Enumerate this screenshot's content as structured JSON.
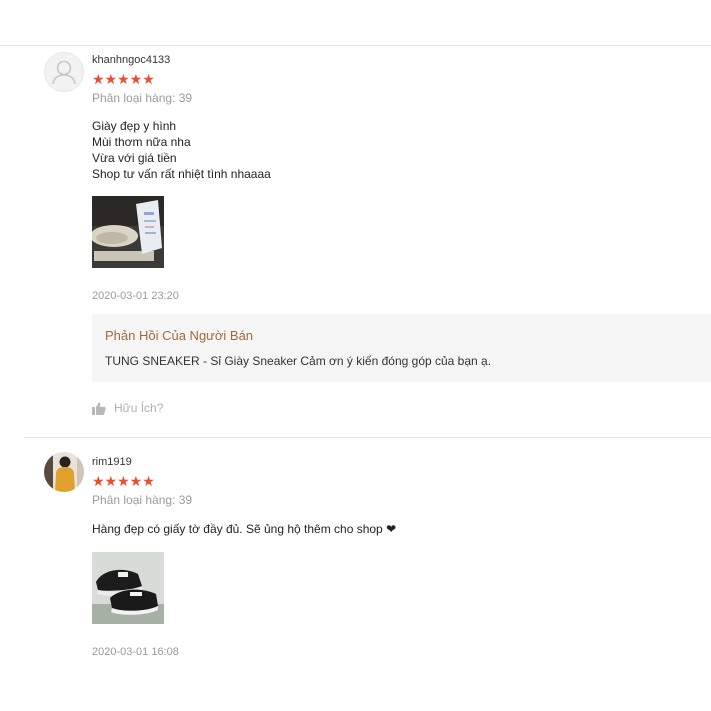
{
  "reviews": [
    {
      "username": "khanhngoc4133",
      "stars": "★★★★★",
      "variation": "Phân loại hàng: 39",
      "comment_lines": [
        "Giày đẹp y hình",
        "Mùi thơm nữa nha",
        "Vừa với giá tiền",
        "Shop tư vấn rất nhiệt tình nhaaaa"
      ],
      "rating": 5,
      "timestamp": "2020-03-01 23:20",
      "seller_reply": {
        "title": "Phản Hồi Của Người Bán",
        "text": "TUNG SNEAKER - Sỉ Giày Sneaker Cảm ơn ý kiến đóng góp của bạn ạ."
      },
      "helpful_label": "Hữu Ích?"
    },
    {
      "username": "rim1919",
      "stars": "★★★★★",
      "variation": "Phân loại hàng: 39",
      "comment_text": "Hàng đẹp có giấy tờ đầy đủ. Sẽ ủng hộ thêm cho shop",
      "comment_heart": "❤",
      "rating": 5,
      "timestamp": "2020-03-01 16:08"
    }
  ],
  "colors": {
    "star": "#ee4d2d",
    "seller_title": "#a06a3a",
    "muted": "#9a9a9a",
    "reply_bg": "#f5f5f5"
  }
}
